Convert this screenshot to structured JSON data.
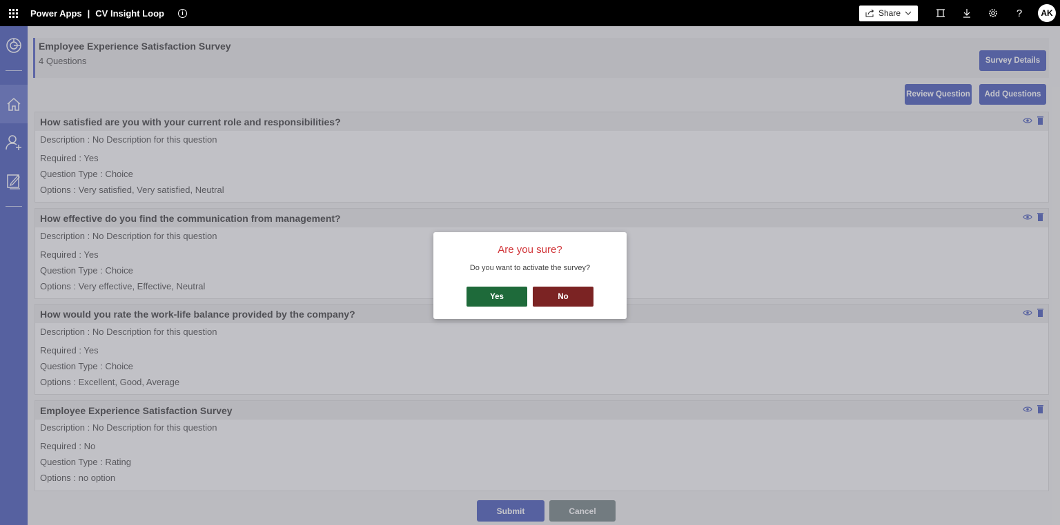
{
  "topbar": {
    "product": "Power Apps",
    "separator": "|",
    "app_name": "CV Insight Loop",
    "info_glyph": "i",
    "share_label": "Share",
    "avatar_initials": "AK",
    "help_glyph": "?"
  },
  "sidebar": {
    "items": [
      {
        "icon": "analytics-icon"
      },
      {
        "icon": "home-icon",
        "active": true
      },
      {
        "icon": "add-user-icon"
      },
      {
        "icon": "edit-form-icon"
      }
    ]
  },
  "survey": {
    "title": "Employee Experience Satisfaction Survey",
    "count": "4 Questions",
    "details_label": "Survey Details",
    "review_label": "Review Question",
    "add_label": "Add Questions"
  },
  "questions": [
    {
      "title": "How satisfied are you with your current role and responsibilities?",
      "description": "Description : No Description for this question",
      "required": "Required : Yes",
      "type": "Question Type : Choice",
      "options": "Options : Very satisfied, Very satisfied, Neutral"
    },
    {
      "title": "How effective do you find the communication from management?",
      "description": "Description : No Description for this question",
      "required": "Required : Yes",
      "type": "Question Type : Choice",
      "options": "Options : Very effective, Effective, Neutral"
    },
    {
      "title": "How would you rate the work-life balance provided by the company?",
      "description": "Description : No Description for this question",
      "required": "Required : Yes",
      "type": "Question Type : Choice",
      "options": "Options : Excellent, Good, Average"
    },
    {
      "title": "Employee Experience Satisfaction Survey",
      "description": "Description : No Description for this question",
      "required": "Required : No",
      "type": "Question Type : Rating",
      "options": "Options : no option"
    }
  ],
  "footer": {
    "submit_label": "Submit",
    "cancel_label": "Cancel"
  },
  "dialog": {
    "title": "Are you sure?",
    "message": "Do you want to activate the survey?",
    "yes_label": "Yes",
    "no_label": "No"
  },
  "colors": {
    "accent": "#3f51b5",
    "danger_title": "#d13438",
    "yes_button": "#1e6a3a",
    "no_button": "#7b2323"
  }
}
